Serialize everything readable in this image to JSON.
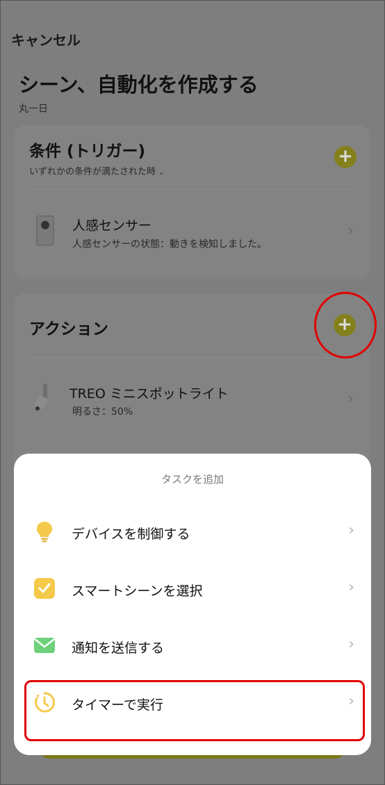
{
  "header": {
    "cancel_label": "キャンセル",
    "title": "シーン、自動化を作成する",
    "subtitle": "丸一日"
  },
  "conditions": {
    "title": "条件 (トリガー)",
    "subtitle": "いずれかの条件が満たされた時",
    "add_label": "+",
    "device": {
      "name": "人感センサー",
      "description": "人感センサーの状態：動きを検知しました。"
    }
  },
  "actions": {
    "title": "アクション",
    "add_label": "+",
    "device": {
      "name": "TREO ミニスポットライト",
      "description": "明るさ：50%"
    }
  },
  "sheet": {
    "title": "タスクを追加",
    "items": [
      {
        "label": "デバイスを制御する",
        "icon": "lightbulb-icon"
      },
      {
        "label": "スマートシーンを選択",
        "icon": "checkbox-icon"
      },
      {
        "label": "通知を送信する",
        "icon": "mail-icon"
      },
      {
        "label": "タイマーで実行",
        "icon": "timer-icon"
      }
    ]
  },
  "colors": {
    "accent_yellow": "#F5C94A",
    "highlight_red": "#E00000",
    "mail_green": "#6DD17B"
  }
}
